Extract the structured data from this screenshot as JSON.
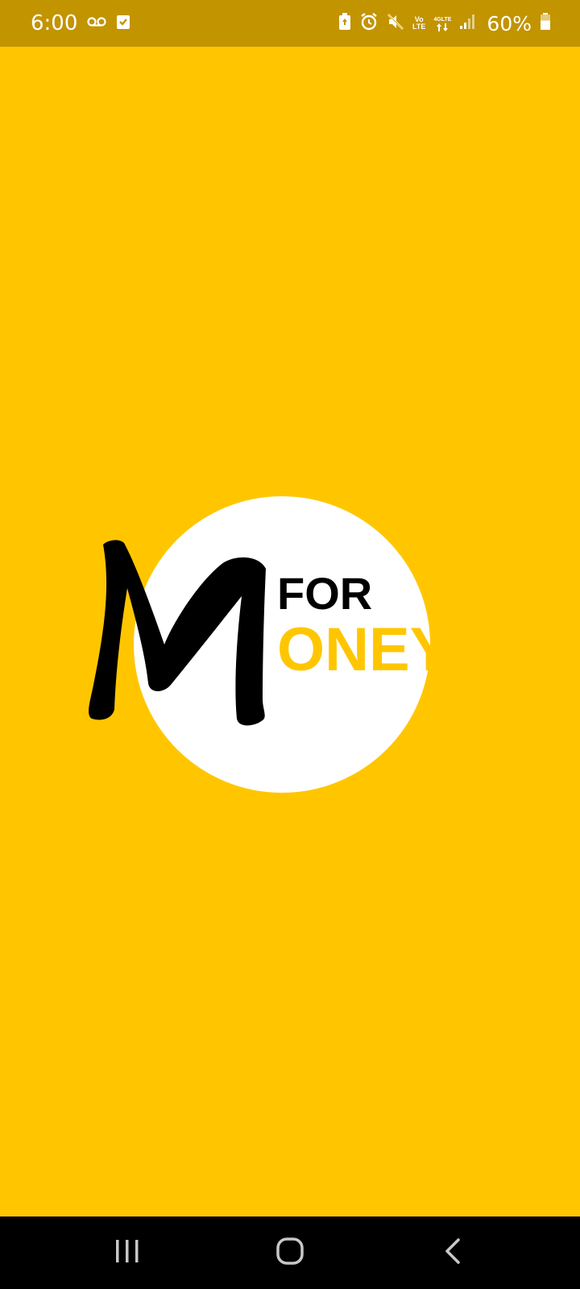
{
  "status_bar": {
    "time": "6:00",
    "left_icons": [
      "voicemail-icon",
      "task-check-icon"
    ],
    "right_icons": [
      "battery-saver-icon",
      "alarm-icon",
      "mute-icon",
      "volte-icon",
      "4g-lte-icon",
      "signal-icon"
    ],
    "volte_label_top": "Vo",
    "volte_label_bottom": "LTE",
    "lte_label": "4GLTE",
    "battery_percent": "60%",
    "battery_level": 0.6
  },
  "splash": {
    "background_color": "#FFC600",
    "logo": {
      "letter_m": "M",
      "word_top": "FOR",
      "word_bottom": "ONEY",
      "circle_color": "#FFFFFF",
      "top_color": "#000000",
      "bottom_color": "#FFC600"
    }
  },
  "nav_bar": {
    "buttons": [
      "recents-icon",
      "home-icon",
      "back-icon"
    ]
  }
}
